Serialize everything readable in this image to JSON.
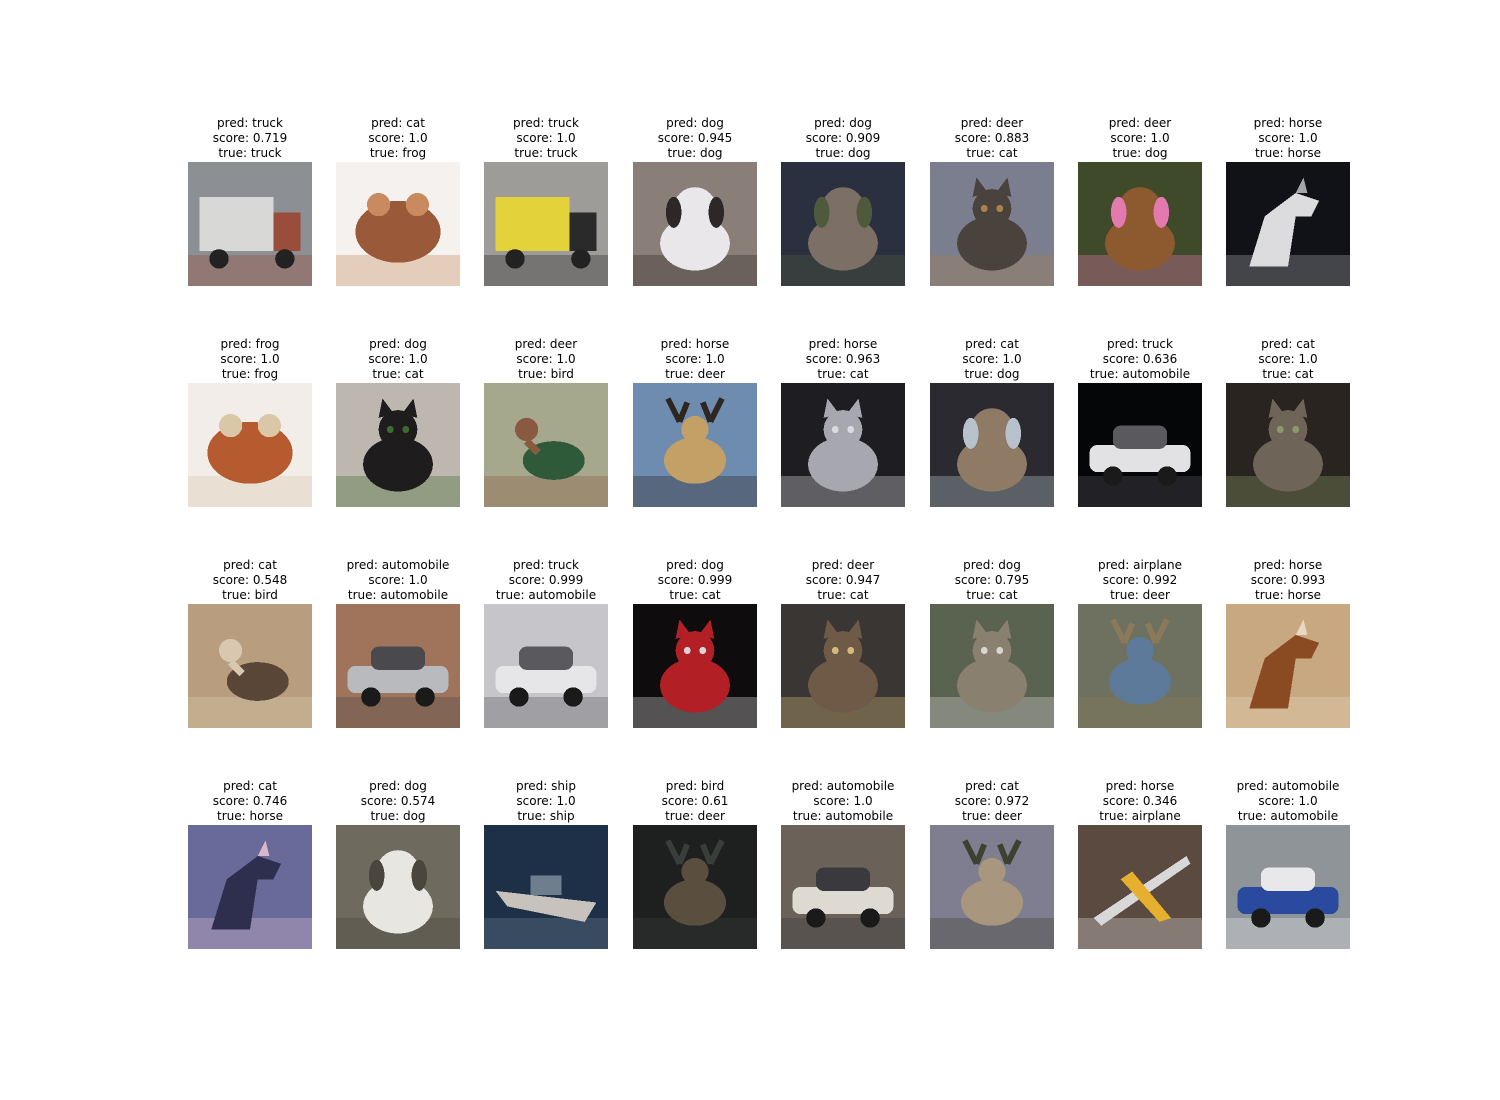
{
  "figure": {
    "rows": [
      [
        {
          "pred": "pred: truck",
          "score": "score: 0.719",
          "true": "true: truck",
          "subject": "truck",
          "bg": "#8c8f94",
          "fg": "#d8d8d6",
          "accent": "#9a4d3a"
        },
        {
          "pred": "pred: cat",
          "score": "score: 1.0",
          "true": "true: frog",
          "subject": "frog",
          "bg": "#f4f1ee",
          "fg": "#9a5a3a",
          "accent": "#c88a5e"
        },
        {
          "pred": "pred: truck",
          "score": "score: 1.0",
          "true": "true: truck",
          "subject": "truck",
          "bg": "#9d9c98",
          "fg": "#e4d23a",
          "accent": "#2a2a2a"
        },
        {
          "pred": "pred: dog",
          "score": "score: 0.945",
          "true": "true: dog",
          "subject": "dog",
          "bg": "#8a7f78",
          "fg": "#e9e7ea",
          "accent": "#2d2727"
        },
        {
          "pred": "pred: dog",
          "score": "score: 0.909",
          "true": "true: dog",
          "subject": "dog",
          "bg": "#2b3040",
          "fg": "#7c7066",
          "accent": "#4f5a3c"
        },
        {
          "pred": "pred: deer",
          "score": "score: 0.883",
          "true": "true: cat",
          "subject": "cat",
          "bg": "#7a7e8e",
          "fg": "#4a433d",
          "accent": "#a88150"
        },
        {
          "pred": "pred: deer",
          "score": "score: 1.0",
          "true": "true: dog",
          "subject": "dog",
          "bg": "#3f4a2a",
          "fg": "#8c5a2e",
          "accent": "#e27ab0"
        },
        {
          "pred": "pred: horse",
          "score": "score: 1.0",
          "true": "true: horse",
          "subject": "horse",
          "bg": "#101218",
          "fg": "#dcdcde",
          "accent": "#a6a6aa"
        }
      ],
      [
        {
          "pred": "pred: frog",
          "score": "score: 1.0",
          "true": "true: frog",
          "subject": "frog",
          "bg": "#f2ede8",
          "fg": "#b65a30",
          "accent": "#d9c7a8"
        },
        {
          "pred": "pred: dog",
          "score": "score: 1.0",
          "true": "true: cat",
          "subject": "cat",
          "bg": "#bdb7b0",
          "fg": "#1e1c1c",
          "accent": "#3e6a32"
        },
        {
          "pred": "pred: deer",
          "score": "score: 1.0",
          "true": "true: bird",
          "subject": "bird",
          "bg": "#a6a88e",
          "fg": "#2f5a3a",
          "accent": "#8a5a40"
        },
        {
          "pred": "pred: horse",
          "score": "score: 1.0",
          "true": "true: deer",
          "subject": "deer",
          "bg": "#6e8bb0",
          "fg": "#c2a066",
          "accent": "#2e2620"
        },
        {
          "pred": "pred: horse",
          "score": "score: 0.963",
          "true": "true: cat",
          "subject": "cat",
          "bg": "#1e1e22",
          "fg": "#a7a7b0",
          "accent": "#d9d9de"
        },
        {
          "pred": "pred: cat",
          "score": "score: 1.0",
          "true": "true: dog",
          "subject": "dog",
          "bg": "#2a2a30",
          "fg": "#8f7a66",
          "accent": "#b7c2cc"
        },
        {
          "pred": "pred: truck",
          "score": "score: 0.636",
          "true": "true: automobile",
          "subject": "automobile",
          "bg": "#050608",
          "fg": "#e2e2e4",
          "accent": "#5a5a5e"
        },
        {
          "pred": "pred: cat",
          "score": "score: 1.0",
          "true": "true: cat",
          "subject": "cat",
          "bg": "#2a2420",
          "fg": "#6e6458",
          "accent": "#8a9a6a"
        }
      ],
      [
        {
          "pred": "pred: cat",
          "score": "score: 0.548",
          "true": "true: bird",
          "subject": "bird",
          "bg": "#b89e7e",
          "fg": "#5a4636",
          "accent": "#d8c8b0"
        },
        {
          "pred": "pred: automobile",
          "score": "score: 1.0",
          "true": "true: automobile",
          "subject": "automobile",
          "bg": "#a0745a",
          "fg": "#b8babe",
          "accent": "#4a4a4e"
        },
        {
          "pred": "pred: truck",
          "score": "score: 0.999",
          "true": "true: automobile",
          "subject": "automobile",
          "bg": "#c6c6ca",
          "fg": "#e6e6e8",
          "accent": "#5a5a5e"
        },
        {
          "pred": "pred: dog",
          "score": "score: 0.999",
          "true": "true: cat",
          "subject": "cat",
          "bg": "#0e0c0c",
          "fg": "#b21f24",
          "accent": "#d6d6d6"
        },
        {
          "pred": "pred: deer",
          "score": "score: 0.947",
          "true": "true: cat",
          "subject": "cat",
          "bg": "#3a3634",
          "fg": "#6e5a46",
          "accent": "#d8b87a"
        },
        {
          "pred": "pred: dog",
          "score": "score: 0.795",
          "true": "true: cat",
          "subject": "cat",
          "bg": "#5a6250",
          "fg": "#8a8070",
          "accent": "#d6d4d2"
        },
        {
          "pred": "pred: airplane",
          "score": "score: 0.992",
          "true": "true: deer",
          "subject": "deer",
          "bg": "#6e7060",
          "fg": "#5e7a9a",
          "accent": "#8a7a5a"
        },
        {
          "pred": "pred: horse",
          "score": "score: 0.993",
          "true": "true: horse",
          "subject": "horse",
          "bg": "#c8a880",
          "fg": "#8a4a22",
          "accent": "#e8d8c0"
        }
      ],
      [
        {
          "pred": "pred: cat",
          "score": "score: 0.746",
          "true": "true: horse",
          "subject": "horse",
          "bg": "#6a6a9a",
          "fg": "#2e2e4e",
          "accent": "#d8b8c8"
        },
        {
          "pred": "pred: dog",
          "score": "score: 0.574",
          "true": "true: dog",
          "subject": "dog",
          "bg": "#6e6a5e",
          "fg": "#e8e6e0",
          "accent": "#4a463e"
        },
        {
          "pred": "pred: ship",
          "score": "score: 1.0",
          "true": "true: ship",
          "subject": "ship",
          "bg": "#1e3048",
          "fg": "#c8c2bc",
          "accent": "#6e7e8e"
        },
        {
          "pred": "pred: bird",
          "score": "score: 0.61",
          "true": "true: deer",
          "subject": "deer",
          "bg": "#1e2020",
          "fg": "#5a4e3e",
          "accent": "#3a3e3a"
        },
        {
          "pred": "pred: automobile",
          "score": "score: 1.0",
          "true": "true: automobile",
          "subject": "automobile",
          "bg": "#6a6258",
          "fg": "#dedad2",
          "accent": "#3a3a3e"
        },
        {
          "pred": "pred: cat",
          "score": "score: 0.972",
          "true": "true: deer",
          "subject": "deer",
          "bg": "#7e7e90",
          "fg": "#a8967e",
          "accent": "#3e4030"
        },
        {
          "pred": "pred: horse",
          "score": "score: 0.346",
          "true": "true: airplane",
          "subject": "airplane",
          "bg": "#5a4a40",
          "fg": "#e6b02e",
          "accent": "#d8d8d8"
        },
        {
          "pred": "pred: automobile",
          "score": "score: 1.0",
          "true": "true: automobile",
          "subject": "automobile",
          "bg": "#8e9498",
          "fg": "#2a4aa0",
          "accent": "#e8e8ea"
        }
      ]
    ]
  }
}
